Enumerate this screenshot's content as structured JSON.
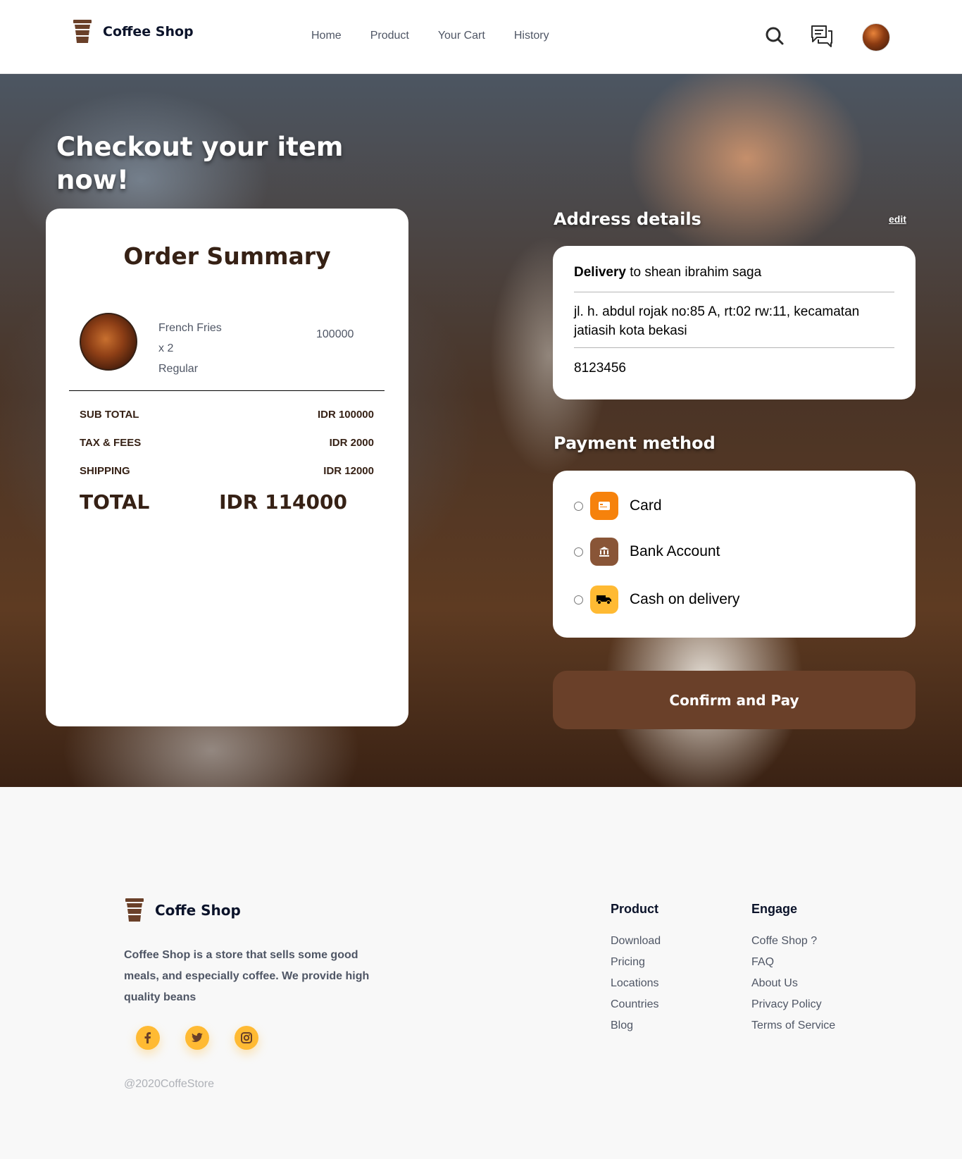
{
  "header": {
    "brand": "Coffee Shop",
    "nav": [
      "Home",
      "Product",
      "Your Cart",
      "History"
    ]
  },
  "hero": {
    "title": "Checkout your item now!"
  },
  "order": {
    "title": "Order Summary",
    "item": {
      "name": "French Fries",
      "qty": "x 2",
      "size": "Regular",
      "price": "100000"
    },
    "rows": [
      {
        "label": "SUB TOTAL",
        "value": "IDR 100000"
      },
      {
        "label": "TAX & FEES",
        "value": "IDR 2000"
      },
      {
        "label": "SHIPPING",
        "value": "IDR 12000"
      }
    ],
    "total_label": "TOTAL",
    "total_value": "IDR 114000"
  },
  "address": {
    "title": "Address details",
    "edit": "edit",
    "delivery_bold": "Delivery",
    "delivery_rest": " to shean ibrahim saga",
    "street": "jl. h. abdul rojak no:85 A, rt:02 rw:11, kecamatan jatiasih kota bekasi",
    "phone": "8123456"
  },
  "payment": {
    "title": "Payment method",
    "options": [
      {
        "label": "Card",
        "icon": "card-icon",
        "color": "#f6820c"
      },
      {
        "label": "Bank Account",
        "icon": "bank-icon",
        "color": "#895537"
      },
      {
        "label": "Cash on delivery",
        "icon": "truck-icon",
        "color": "#ffba33"
      }
    ]
  },
  "confirm_label": "Confirm and Pay",
  "footer": {
    "brand": "Coffe Shop",
    "description": "Coffee Shop is a store that sells some good meals, and especially coffee. We provide high quality beans",
    "copyright": "@2020CoffeStore",
    "product_col": {
      "title": "Product",
      "links": [
        "Download",
        "Pricing",
        "Locations",
        "Countries",
        "Blog"
      ]
    },
    "engage_col": {
      "title": "Engage",
      "links": [
        "Coffe Shop ?",
        "FAQ",
        "About Us",
        "Privacy Policy",
        "Terms of Service"
      ]
    },
    "socials": [
      "facebook-icon",
      "twitter-icon",
      "instagram-icon"
    ]
  },
  "colors": {
    "brand_brown": "#6a4029",
    "accent_yellow": "#ffba33",
    "dark_text": "#362115"
  }
}
